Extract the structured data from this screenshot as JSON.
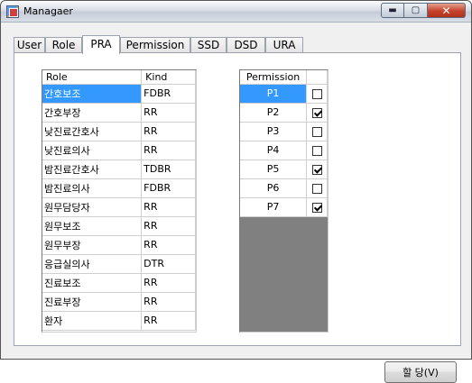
{
  "window": {
    "title": "Managaer",
    "controls": {
      "minimize": "▬",
      "maximize": "▢",
      "close": "✕"
    }
  },
  "tabs": [
    {
      "label": "User"
    },
    {
      "label": "Role"
    },
    {
      "label": "PRA"
    },
    {
      "label": "Permission"
    },
    {
      "label": "SSD"
    },
    {
      "label": "DSD"
    },
    {
      "label": "URA"
    }
  ],
  "active_tab": "PRA",
  "role_grid": {
    "headers": {
      "role": "Role",
      "kind": "Kind"
    },
    "rows": [
      {
        "role": "간호보조",
        "kind": "FDBR",
        "selected": true
      },
      {
        "role": "간호부장",
        "kind": "RR"
      },
      {
        "role": "낮진료간호사",
        "kind": "RR"
      },
      {
        "role": "낮진료의사",
        "kind": "RR"
      },
      {
        "role": "밤진료간호사",
        "kind": "TDBR"
      },
      {
        "role": "밤진료의사",
        "kind": "FDBR"
      },
      {
        "role": "원무담당자",
        "kind": "RR"
      },
      {
        "role": "원무보조",
        "kind": "RR"
      },
      {
        "role": "원무부장",
        "kind": "RR"
      },
      {
        "role": "응급실의사",
        "kind": "DTR"
      },
      {
        "role": "진료보조",
        "kind": "RR"
      },
      {
        "role": "진료부장",
        "kind": "RR"
      },
      {
        "role": "환자",
        "kind": "RR"
      }
    ]
  },
  "permission_grid": {
    "headers": {
      "permission": "Permission",
      "check": ""
    },
    "rows": [
      {
        "name": "P1",
        "checked": false,
        "selected": true
      },
      {
        "name": "P2",
        "checked": true
      },
      {
        "name": "P3",
        "checked": false
      },
      {
        "name": "P4",
        "checked": false
      },
      {
        "name": "P5",
        "checked": true
      },
      {
        "name": "P6",
        "checked": false
      },
      {
        "name": "P7",
        "checked": true
      }
    ]
  },
  "assign_button": {
    "label": "할 당(V)"
  },
  "colors": {
    "selection": "#3399ff",
    "grid_empty": "#808080"
  }
}
